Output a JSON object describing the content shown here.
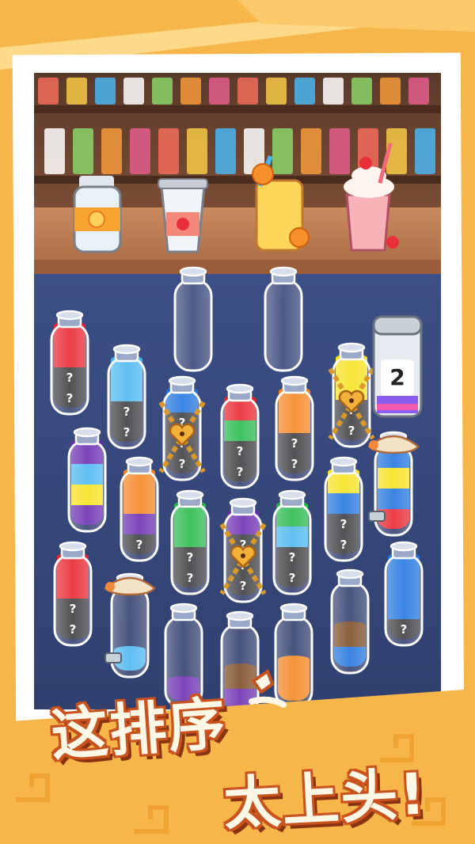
{
  "captions": {
    "line1": "这排序",
    "line2": "太上头!"
  },
  "hidden_mark": "?",
  "powerup": {
    "count": "2"
  },
  "colors": {
    "red": "#e8232d",
    "blue_light": "#4ab6f0",
    "blue": "#1f74e0",
    "green": "#27b84a",
    "orange": "#f5841f",
    "yellow": "#f6e11b",
    "purple": "#6a2bb0",
    "brown": "#7a4a22",
    "unknown": "#3b3b3f"
  },
  "counter_icons": [
    "jar-icon",
    "cup-icon",
    "orange-juice-icon",
    "strawberry-shake-icon"
  ],
  "bottles": [
    {
      "name": "bottle-1",
      "layers": [
        "unknown",
        "unknown",
        "red",
        "red"
      ],
      "cover": "none"
    },
    {
      "name": "bottle-2",
      "layers": [
        "unknown",
        "unknown",
        "blue_light",
        "blue_light"
      ],
      "cover": "none"
    },
    {
      "name": "bottle-3",
      "layers": [
        "unknown",
        "unknown",
        "unknown",
        "blue"
      ],
      "cover": "chain"
    },
    {
      "name": "bottle-4",
      "layers": [
        "unknown",
        "unknown",
        "green",
        "red"
      ],
      "cover": "none"
    },
    {
      "name": "bottle-5",
      "layers": [
        "unknown",
        "unknown",
        "orange",
        "orange"
      ],
      "cover": "none"
    },
    {
      "name": "bottle-6",
      "layers": [
        "unknown",
        "unknown",
        "yellow",
        "yellow"
      ],
      "cover": "chain"
    },
    {
      "name": "bottle-7",
      "layers": [
        "purple",
        "yellow",
        "blue_light",
        "purple"
      ],
      "cover": "none"
    },
    {
      "name": "bottle-8",
      "layers": [
        "unknown",
        "purple",
        "orange",
        "orange"
      ],
      "cover": "none"
    },
    {
      "name": "bottle-9",
      "layers": [
        "unknown",
        "unknown",
        "green",
        "green"
      ],
      "cover": "none"
    },
    {
      "name": "bottle-10",
      "layers": [
        "unknown",
        "unknown",
        "unknown",
        "purple"
      ],
      "cover": "chain"
    },
    {
      "name": "bottle-11",
      "layers": [
        "unknown",
        "unknown",
        "blue_light",
        "green"
      ],
      "cover": "none"
    },
    {
      "name": "bottle-12",
      "layers": [
        "unknown",
        "unknown",
        "blue",
        "yellow"
      ],
      "cover": "none"
    },
    {
      "name": "bottle-13",
      "layers": [
        "red",
        "blue",
        "yellow",
        "blue"
      ],
      "cover": "cloth"
    },
    {
      "name": "bottle-14",
      "layers": [
        "unknown",
        "unknown",
        "red",
        "red"
      ],
      "cover": "none"
    },
    {
      "name": "bottle-15",
      "layers": [
        "blue_light"
      ],
      "cover": "cloth"
    },
    {
      "name": "bottle-16",
      "layers": [
        "unknown",
        "blue",
        "blue",
        "blue"
      ],
      "cover": "none"
    },
    {
      "name": "bottle-17",
      "layers": [
        "purple"
      ],
      "cover": "none"
    },
    {
      "name": "bottle-18",
      "layers": [
        "purple",
        "brown"
      ],
      "cover": "none"
    },
    {
      "name": "bottle-19",
      "layers": [
        "orange",
        "orange"
      ],
      "cover": "none"
    },
    {
      "name": "bottle-20",
      "layers": [
        "blue",
        "brown"
      ],
      "cover": "none"
    },
    {
      "name": "bottle-21",
      "layers": [],
      "cover": "none"
    },
    {
      "name": "bottle-22",
      "layers": [],
      "cover": "none"
    }
  ]
}
